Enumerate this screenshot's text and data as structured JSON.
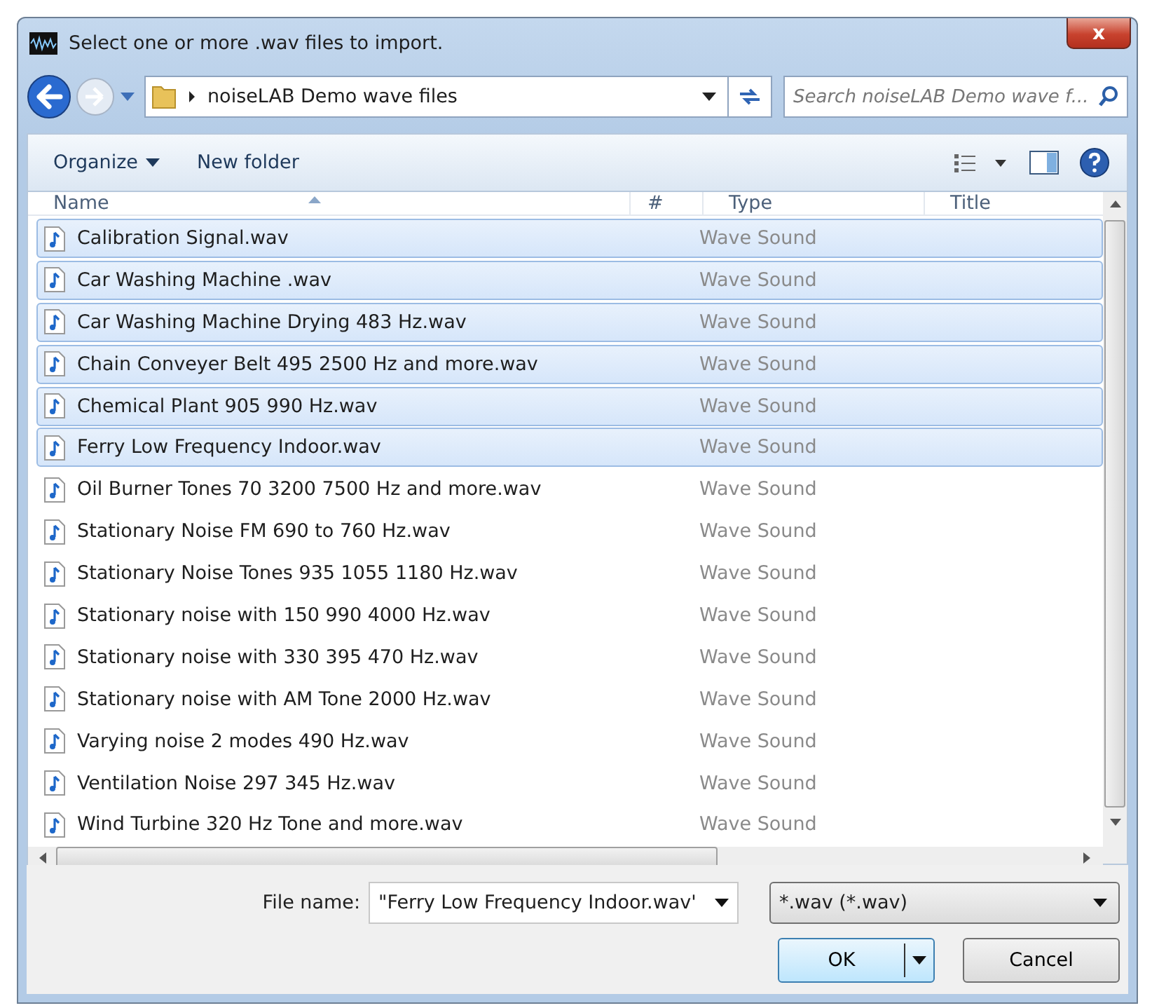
{
  "window": {
    "title": "Select one or more .wav files to import.",
    "close": "x"
  },
  "address": {
    "path": "noiseLAB Demo wave files",
    "search_placeholder": "Search noiseLAB Demo wave f..."
  },
  "toolbar": {
    "organize": "Organize",
    "new_folder": "New folder"
  },
  "table": {
    "columns": [
      "Name",
      "#",
      "Type",
      "Title"
    ],
    "rows": [
      {
        "name": "Calibration Signal.wav",
        "type": "Wave Sound",
        "selected": true
      },
      {
        "name": "Car Washing Machine  .wav",
        "type": "Wave Sound",
        "selected": true
      },
      {
        "name": "Car Washing Machine Drying 483 Hz.wav",
        "type": "Wave Sound",
        "selected": true
      },
      {
        "name": "Chain Conveyer Belt 495 2500 Hz and more.wav",
        "type": "Wave Sound",
        "selected": true
      },
      {
        "name": "Chemical Plant 905 990 Hz.wav",
        "type": "Wave Sound",
        "selected": true
      },
      {
        "name": "Ferry Low Frequency Indoor.wav",
        "type": "Wave Sound",
        "selected": true
      },
      {
        "name": "Oil Burner Tones 70 3200 7500 Hz and more.wav",
        "type": "Wave Sound",
        "selected": false
      },
      {
        "name": "Stationary Noise FM 690 to 760 Hz.wav",
        "type": "Wave Sound",
        "selected": false
      },
      {
        "name": "Stationary Noise Tones 935 1055 1180 Hz.wav",
        "type": "Wave Sound",
        "selected": false
      },
      {
        "name": "Stationary noise with 150 990 4000 Hz.wav",
        "type": "Wave Sound",
        "selected": false
      },
      {
        "name": "Stationary noise with 330 395 470 Hz.wav",
        "type": "Wave Sound",
        "selected": false
      },
      {
        "name": "Stationary noise with AM Tone 2000 Hz.wav",
        "type": "Wave Sound",
        "selected": false
      },
      {
        "name": "Varying noise 2 modes 490 Hz.wav",
        "type": "Wave Sound",
        "selected": false
      },
      {
        "name": "Ventilation Noise 297 345 Hz.wav",
        "type": "Wave Sound",
        "selected": false
      },
      {
        "name": "Wind Turbine 320 Hz Tone and more.wav",
        "type": "Wave Sound",
        "selected": false
      }
    ]
  },
  "footer": {
    "file_name_label": "File name:",
    "file_name_value": "\"Ferry Low Frequency Indoor.wav'",
    "filter": "*.wav (*.wav)",
    "ok": "OK",
    "cancel": "Cancel"
  }
}
